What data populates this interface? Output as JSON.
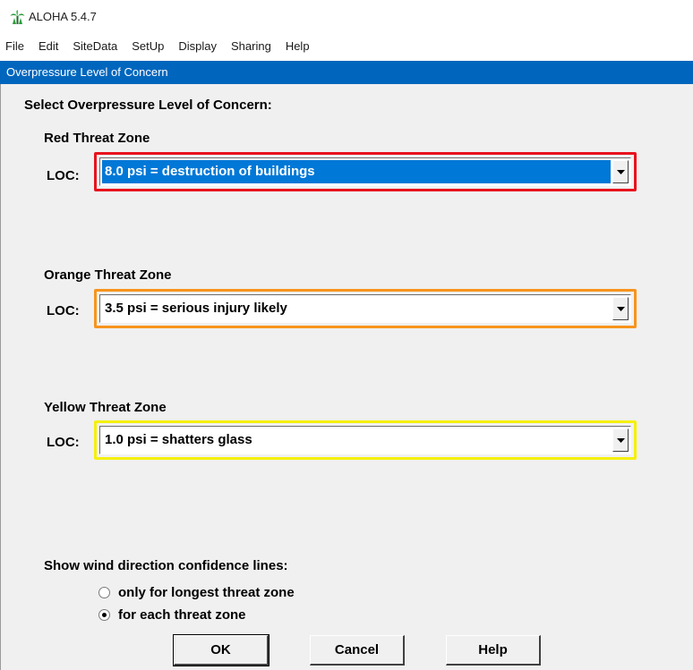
{
  "app": {
    "title": "ALOHA 5.4.7",
    "icon": "palm-tree-icon"
  },
  "menu": [
    "File",
    "Edit",
    "SiteData",
    "SetUp",
    "Display",
    "Sharing",
    "Help"
  ],
  "dialog": {
    "title": "Overpressure Level of Concern",
    "heading": "Select Overpressure Level of Concern:",
    "loc_label": "LOC:",
    "zones": [
      {
        "heading": "Red Threat Zone",
        "value": "8.0 psi = destruction of buildings",
        "color": "#e8131d",
        "selected": true
      },
      {
        "heading": "Orange Threat Zone",
        "value": "3.5 psi = serious injury likely",
        "color": "#f7941d",
        "selected": false
      },
      {
        "heading": "Yellow Threat Zone",
        "value": "1.0 psi = shatters glass",
        "color": "#f5f00a",
        "selected": false
      }
    ],
    "confidence": {
      "label": "Show wind direction confidence lines:",
      "options": [
        {
          "label": "only for longest threat zone",
          "checked": false
        },
        {
          "label": "for each threat zone",
          "checked": true
        }
      ]
    },
    "buttons": {
      "ok": "OK",
      "cancel": "Cancel",
      "help": "Help"
    }
  },
  "colors": {
    "dialog_title_bg": "#0066bd",
    "selection": "#0078d7"
  }
}
